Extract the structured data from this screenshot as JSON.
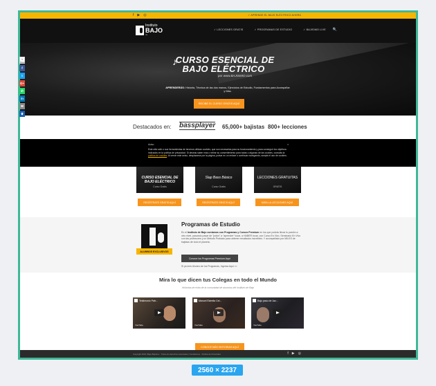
{
  "topbar": {
    "socials": [
      "f",
      "▶",
      "◎"
    ],
    "cta": "✓ APRENDE EL BAJO ELÉCTRICO AHORA"
  },
  "nav": {
    "logo_line1": "Instituto",
    "logo_line2": "BAJO",
    "logo_line3": "de",
    "menu": [
      "✓  LECCIONES GRATIS",
      "✓  PROGRAMAS DE ESTUDIO",
      "✓  BAJISIMO LIVE"
    ],
    "search_icon": "🔍"
  },
  "hero": {
    "title1": "CURSO ESENCIAL DE",
    "title2": "BAJO ELÉCTRICO",
    "byline": "por www.BAJISIMO.com",
    "subtitle_bold": "APRENDERÁS:",
    "subtitle": " Historia, Técnica de las dos manos, Ejercicios de Estudio, Fundamentos para Acompañar y Más.",
    "button": "RECIBE EL CURSO GRATIS AQUÍ"
  },
  "share": {
    "count": "1",
    "count_label": "Shares",
    "items": [
      {
        "glyph": "f",
        "color": "#3b5998"
      },
      {
        "glyph": "t",
        "color": "#1da1f2"
      },
      {
        "glyph": "G+",
        "color": "#dd4b39"
      },
      {
        "glyph": "✆",
        "color": "#25d366"
      },
      {
        "glyph": "in",
        "color": "#0077b5"
      },
      {
        "glyph": "✉",
        "color": "#888888"
      },
      {
        "glyph": "♛",
        "color": "#1a5fb4"
      }
    ]
  },
  "featured": {
    "label": "Destacados en:",
    "brands": [
      "bassplayer",
      "65,000+ bajistas",
      "800+ lecciones"
    ]
  },
  "cookie": {
    "heading": "Aviso",
    "close": "×",
    "text": "Este sitio web o sus herramientas de terceros utilizan cookies, que son necesarias para su funcionamiento y para conseguir los objetivos indicados en la política de privacidad. Si deseas saber más o retirar su consentimiento para todas o algunas de las cookies, consulta la ",
    "link": "política de cookies",
    "text2": ". Al cerrar este aviso, desplazarse por la página, pulsar en un enlace o continuar navegando, acepta el uso de cookies."
  },
  "courses": [
    {
      "title": "CURSO ESENCIAL DE BAJO ELÉCTRICO",
      "sub": "Curso Gratis",
      "button": "REGÍSTRATE GRATIS AQUÍ"
    },
    {
      "title": "Slap Bass Básico",
      "sub": "Curso Gratis",
      "button": "REGÍSTRATE GRATIS AQUÍ"
    },
    {
      "title": "LECCIONES GRATUITAS",
      "sub": "GRATIS",
      "button": "MIRA LA LECCIONES AQUÍ"
    }
  ],
  "programs": {
    "ribbon": "ALUMNOS EXCLUSIVOS",
    "heading": "Programas de Estudio",
    "text_a": "En el ",
    "text_b": "Instituto de Bajo contamos con Programas y Cursos Premium",
    "text_c": " en los que podrás llevar tu pasión a otro nivel, pasando pasar de \"jodón\" a \"aprender\" tocar, a HABER tocar, con Curso En Vivo, Seminario En Vivo con las profesores y un Método Probado para obtener resultados increíbles. Y acompañado por MILES de bajistas de todo el planeta.",
    "button": "Conoce los Programas Premium Aquí",
    "link": "Si ya eres Alumno de los Programas, Ingresa Aquí >>"
  },
  "testimonials": {
    "heading": "Mira lo que dicen tus Colegas en todo el Mundo",
    "sub": "Historias de éxito de la comunidad de alumnos del Instituto de Bajo",
    "videos": [
      {
        "title": "Testimonio Patr..."
      },
      {
        "title": "Manuel Estrella Cel..."
      },
      {
        "title": "Bajo paso de Jaz..."
      }
    ],
    "video_brand": "YouTube",
    "button": "CONOCE MÁS HISTORIAS AQUÍ"
  },
  "footer": {
    "copyright": "Copyright 2023 | Bajo Bajísimo · Todos los derechos reservados | Condiciones · Política de Privacidad",
    "socials": [
      "f",
      "▶",
      "◎"
    ]
  },
  "dimension_badge": "2560 × 2237"
}
